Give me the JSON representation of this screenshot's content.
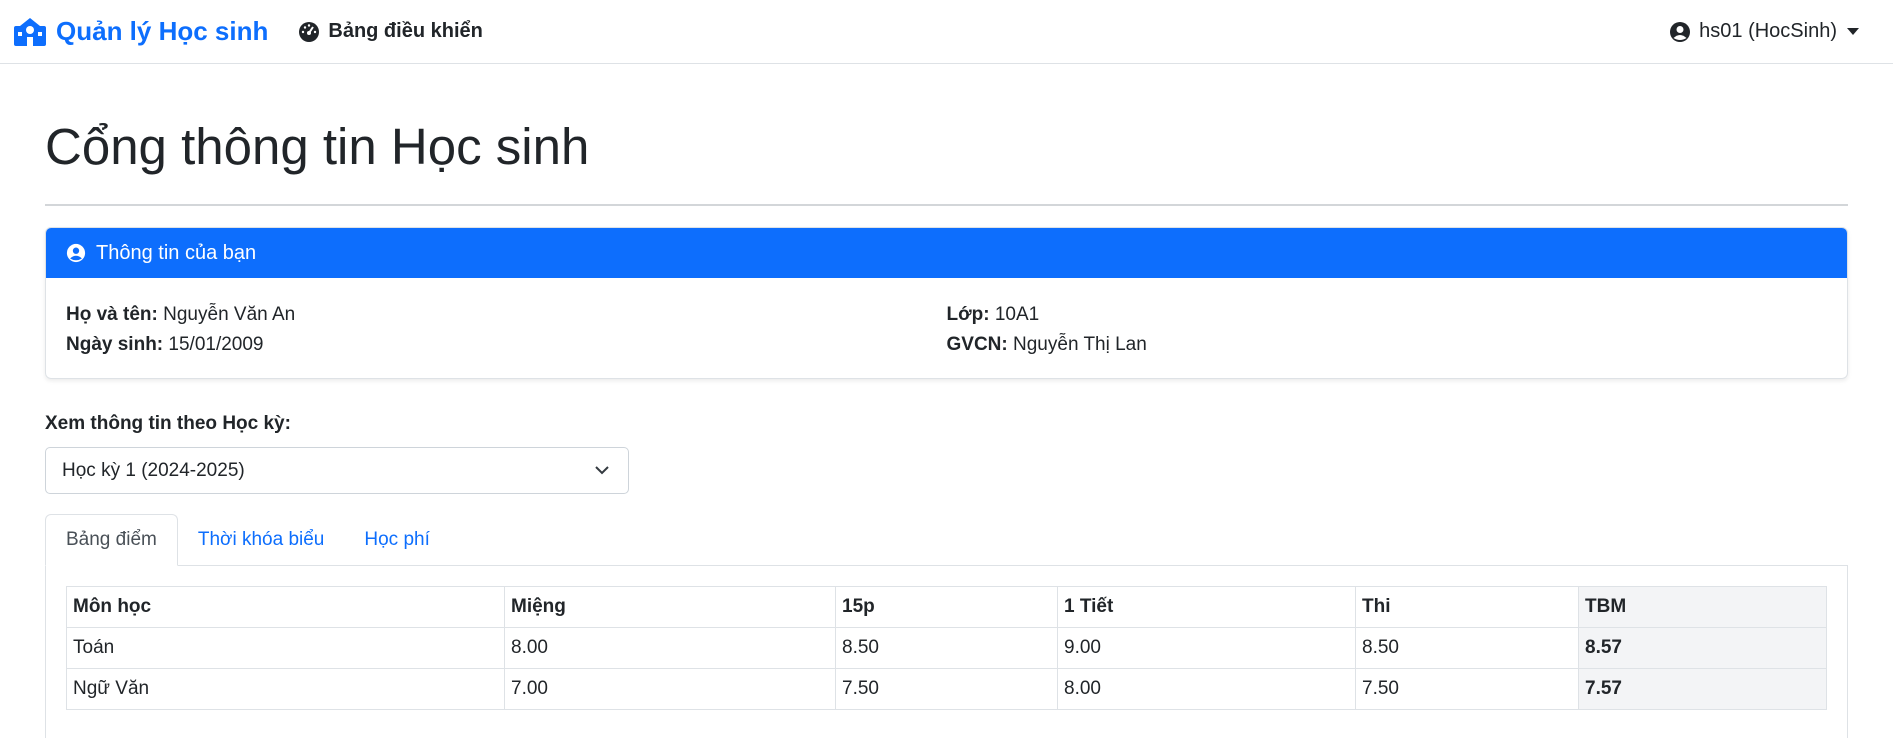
{
  "navbar": {
    "brand": "Quản lý Học sinh",
    "brand_icon": "school-icon",
    "dashboard": "Bảng điều khiển",
    "dashboard_icon": "tachometer-icon",
    "user": "hs01 (HocSinh)",
    "user_icon": "user-circle-icon"
  },
  "page": {
    "title": "Cổng thông tin Học sinh"
  },
  "info_card": {
    "header": "Thông tin của bạn",
    "fields": {
      "name_label": "Họ và tên:",
      "name": "Nguyễn Văn An",
      "dob_label": "Ngày sinh:",
      "dob": "15/01/2009",
      "class_label": "Lớp:",
      "class": "10A1",
      "teacher_label": "GVCN:",
      "teacher": "Nguyễn Thị Lan"
    }
  },
  "semester": {
    "label": "Xem thông tin theo Học kỳ:",
    "selected": "Học kỳ 1 (2024-2025)"
  },
  "tabs": [
    {
      "label": "Bảng điểm",
      "active": true
    },
    {
      "label": "Thời khóa biểu",
      "active": false
    },
    {
      "label": "Học phí",
      "active": false
    }
  ],
  "grades": {
    "headers": [
      "Môn học",
      "Miệng",
      "15p",
      "1 Tiết",
      "Thi",
      "TBM"
    ],
    "rows": [
      [
        "Toán",
        "8.00",
        "8.50",
        "9.00",
        "8.50",
        "8.57"
      ],
      [
        "Ngữ Văn",
        "7.00",
        "7.50",
        "8.00",
        "7.50",
        "7.57"
      ]
    ]
  },
  "colors": {
    "primary": "#0d6efd",
    "text": "#212529"
  }
}
